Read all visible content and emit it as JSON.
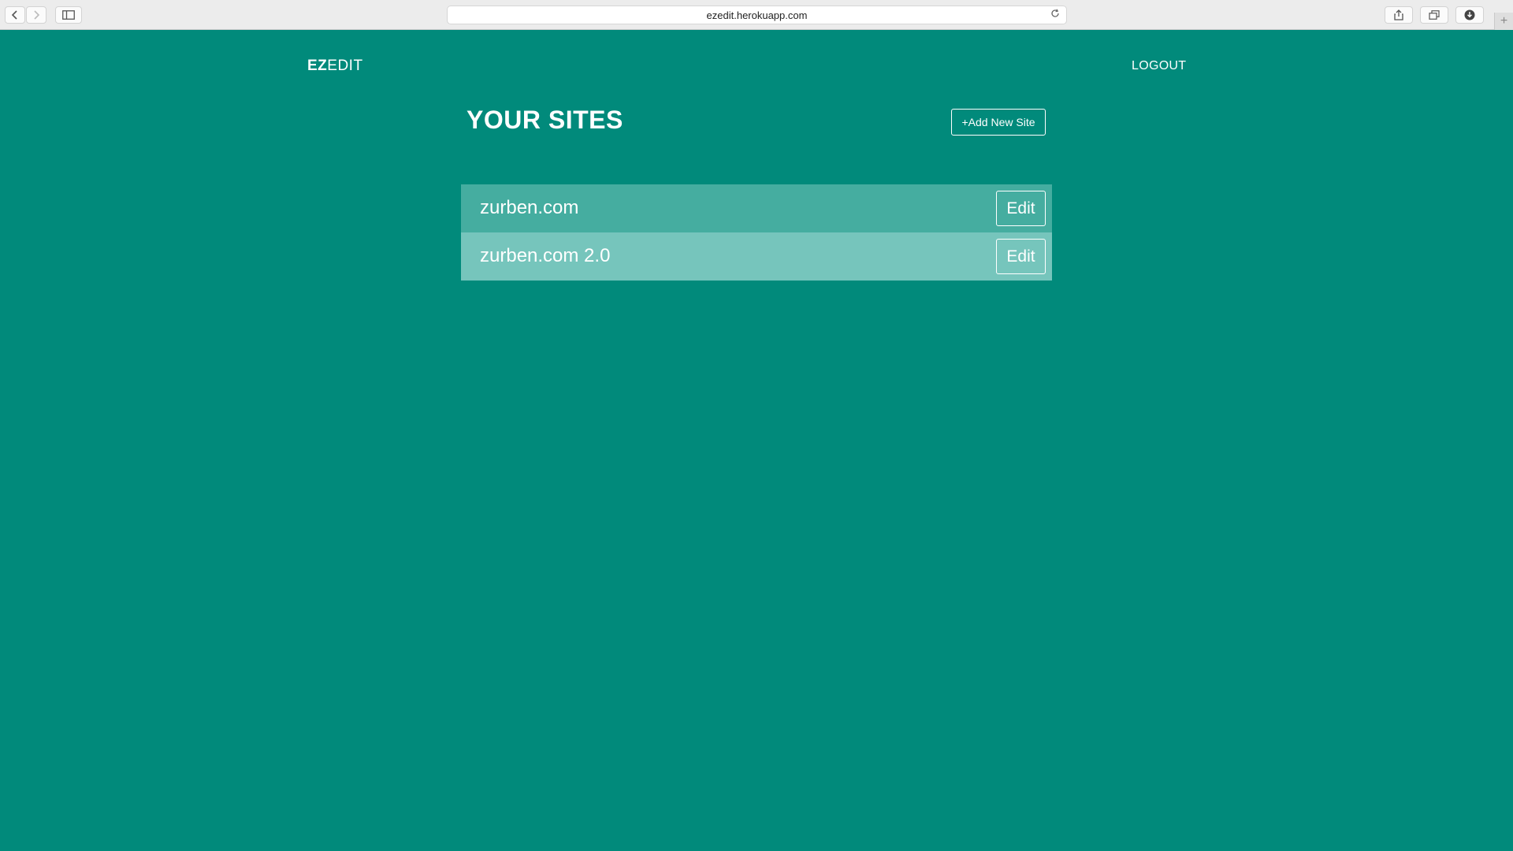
{
  "browser": {
    "url": "ezedit.herokuapp.com",
    "icons": {
      "back": "chevron-left-icon",
      "forward": "chevron-right-icon",
      "sidebar": "sidebar-icon",
      "reload": "reload-icon",
      "share": "share-icon",
      "tabs": "tabs-icon",
      "download": "download-icon",
      "new_tab": "plus-icon"
    }
  },
  "header": {
    "logo_bold": "EZ",
    "logo_rest": "EDIT",
    "logout_label": "LOGOUT"
  },
  "main": {
    "title": "YOUR SITES",
    "add_button_label": "+Add New Site",
    "sites": [
      {
        "name": "zurben.com",
        "edit_label": "Edit"
      },
      {
        "name": "zurben.com 2.0",
        "edit_label": "Edit"
      }
    ]
  },
  "colors": {
    "background": "#018a7b",
    "row_primary": "#45ada0",
    "row_secondary": "#76c5bc",
    "text": "#ffffff"
  }
}
